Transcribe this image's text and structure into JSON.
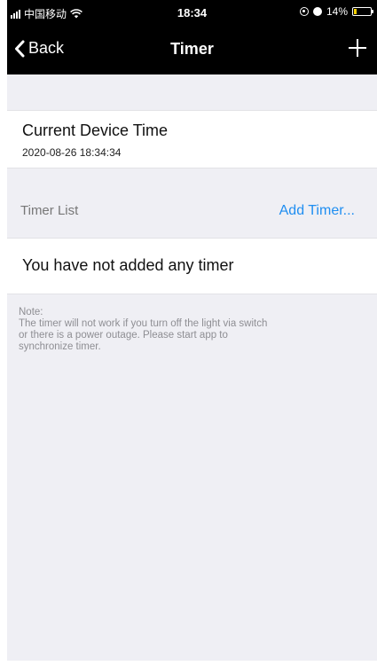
{
  "status_bar": {
    "carrier": "中国移动",
    "time": "18:34",
    "battery_percent": "14%",
    "battery_level": 0.14
  },
  "nav": {
    "back_label": "Back",
    "title": "Timer",
    "add_icon": "plus-icon",
    "back_icon": "chevron-left-icon"
  },
  "device_time": {
    "label": "Current Device Time",
    "value": "2020-08-26 18:34:34"
  },
  "timer_list": {
    "label": "Timer List",
    "add_link": "Add Timer...",
    "empty_message": "You have not added any timer"
  },
  "note": {
    "title": "Note:",
    "lines": [
      "The timer will not work if you turn off the light via switch",
      "or there is a power outage. Please start app to",
      "synchronize timer."
    ]
  },
  "colors": {
    "background": "#efeff4",
    "nav_background": "#000000",
    "accent": "#1f8ef1",
    "secondary_text": "#8e8e93",
    "battery_fill": "#f5d000"
  }
}
